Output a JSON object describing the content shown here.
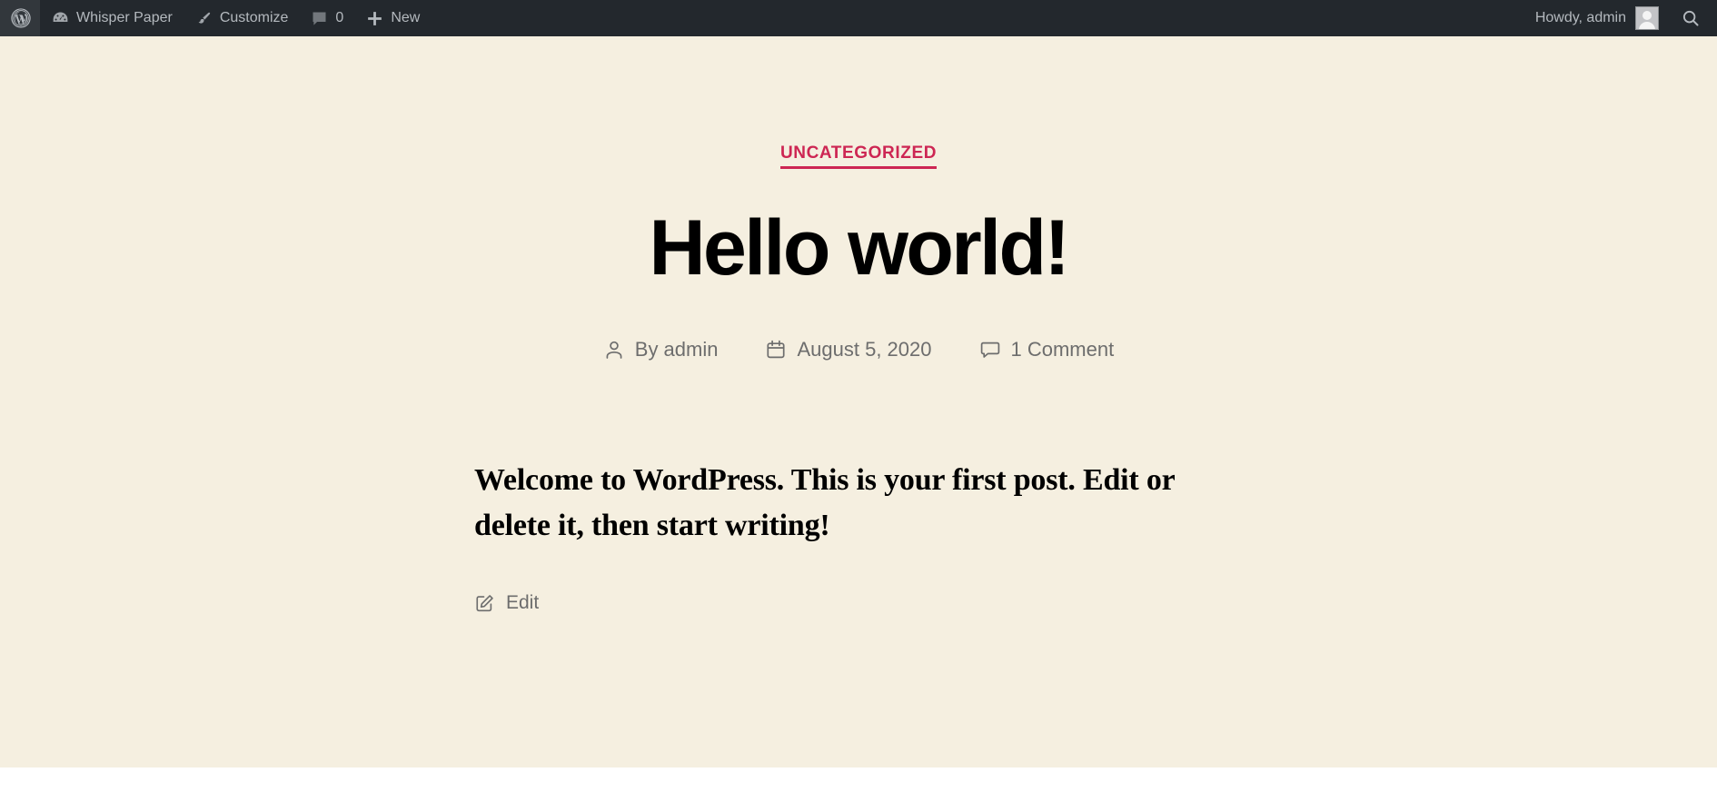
{
  "admin_bar": {
    "wp_logo": {
      "name": "wordpress-logo",
      "label": "About WordPress"
    },
    "site_name": "Whisper Paper",
    "customize_label": "Customize",
    "comments_count": "0",
    "new_label": "New",
    "howdy": "Howdy, admin",
    "search_label": "Search",
    "icons": {
      "dashboard": "dashboard-icon",
      "paintbrush": "paintbrush-icon",
      "comment": "comment-icon",
      "plus": "plus-icon",
      "avatar": "avatar-icon",
      "search": "search-icon"
    }
  },
  "post": {
    "category": "UNCATEGORIZED",
    "title": "Hello world!",
    "meta": {
      "author_label": "By admin",
      "date": "August 5, 2020",
      "comments": "1 Comment"
    },
    "content": "Welcome to WordPress. This is your first post. Edit or delete it, then start writing!",
    "edit_label": "Edit"
  },
  "colors": {
    "admin_bar_bg": "#23282d",
    "admin_bar_text": "#b4b9be",
    "page_bg": "#f5efe0",
    "accent": "#cd2653",
    "title": "#000000",
    "meta_text": "#6d6d6d"
  }
}
